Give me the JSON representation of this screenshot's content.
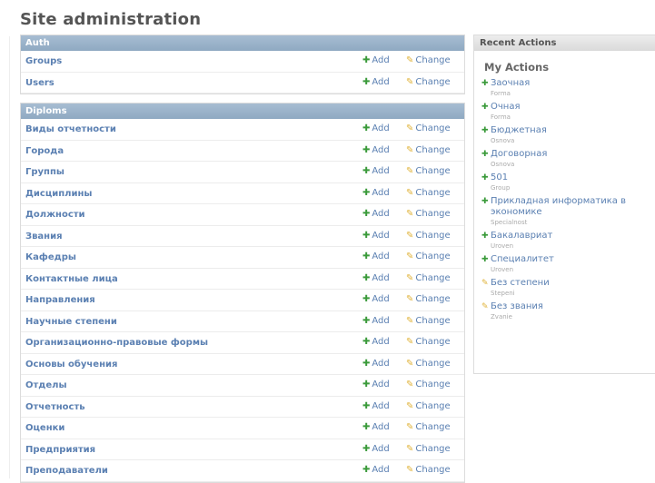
{
  "page": {
    "title": "Site administration"
  },
  "common": {
    "add_label": "Add",
    "change_label": "Change"
  },
  "apps": [
    {
      "caption": "Auth",
      "models": [
        "Groups",
        "Users"
      ]
    },
    {
      "caption": "Diploms",
      "models": [
        "Виды отчетности",
        "Города",
        "Группы",
        "Дисциплины",
        "Должности",
        "Звания",
        "Кафедры",
        "Контактные лица",
        "Направления",
        "Научные степени",
        "Организационно-правовые формы",
        "Основы обучения",
        "Отделы",
        "Отчетность",
        "Оценки",
        "Предприятия",
        "Преподаватели"
      ]
    }
  ],
  "recent_actions": {
    "caption": "Recent Actions",
    "subtitle": "My Actions",
    "items": [
      {
        "kind": "add",
        "name": "Заочная",
        "type": "Forma"
      },
      {
        "kind": "add",
        "name": "Очная",
        "type": "Forma"
      },
      {
        "kind": "add",
        "name": "Бюджетная",
        "type": "Osnova"
      },
      {
        "kind": "add",
        "name": "Договорная",
        "type": "Osnova"
      },
      {
        "kind": "add",
        "name": "501",
        "type": "Group"
      },
      {
        "kind": "add",
        "name": "Прикладная информатика в экономике",
        "type": "Specialnost"
      },
      {
        "kind": "add",
        "name": "Бакалавриат",
        "type": "Uroven"
      },
      {
        "kind": "add",
        "name": "Специалитет",
        "type": "Uroven"
      },
      {
        "kind": "change",
        "name": "Без степени",
        "type": "Stepeni"
      },
      {
        "kind": "change",
        "name": "Без звания",
        "type": "Zvanie"
      }
    ]
  },
  "icons": {
    "add": "plus-icon",
    "change": "pencil-icon"
  },
  "colors": {
    "link": "#5b80b2",
    "module_caption_bg": "#8fa9c2",
    "add_icon": "#3a9a3a",
    "change_icon": "#e0b33a"
  }
}
